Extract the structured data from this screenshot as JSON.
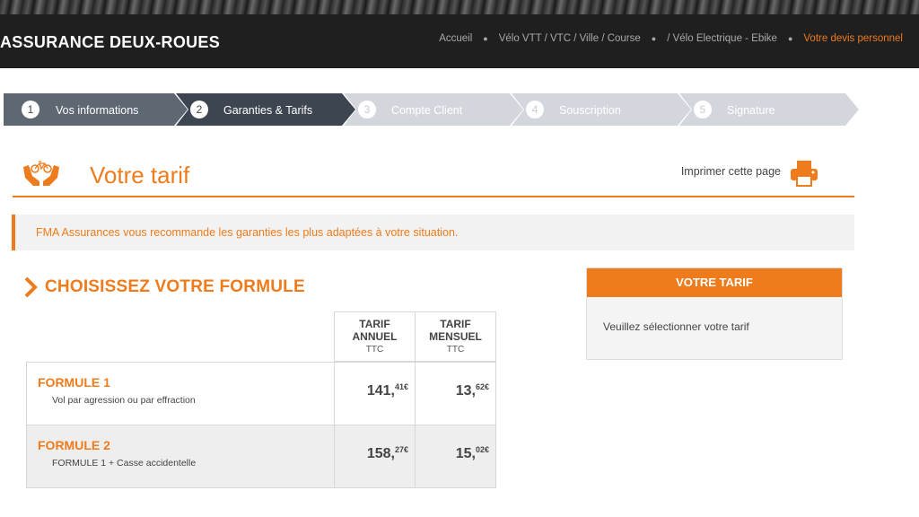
{
  "header": {
    "brand": "ASSURANCE DEUX-ROUES",
    "breadcrumb": [
      {
        "label": "Accueil"
      },
      {
        "label": "Vélo VTT / VTC / Ville / Course"
      },
      {
        "label": "/ Vélo Electrique - Ebike"
      },
      {
        "label": "Votre devis personnel"
      }
    ]
  },
  "steps": [
    {
      "num": "1",
      "label": "Vos informations"
    },
    {
      "num": "2",
      "label": "Garanties & Tarifs"
    },
    {
      "num": "3",
      "label": "Compte Client"
    },
    {
      "num": "4",
      "label": "Souscription"
    },
    {
      "num": "5",
      "label": "Signature"
    }
  ],
  "page": {
    "title": "Votre tarif",
    "print_label": "Imprimer cette page",
    "notice": "FMA Assurances vous recommande les garanties les plus adaptées à votre situation.",
    "section_title": "CHOISISSEZ VOTRE FORMULE"
  },
  "table": {
    "headers": [
      {
        "line1": "TARIF",
        "line2": "ANNUEL",
        "line3": "TTC"
      },
      {
        "line1": "TARIF",
        "line2": "MENSUEL",
        "line3": "TTC"
      }
    ],
    "rows": [
      {
        "name": "FORMULE 1",
        "desc": "Vol par agression ou par effraction",
        "annual": {
          "int": "141,",
          "dec": "41€"
        },
        "monthly": {
          "int": "13,",
          "dec": "62€"
        }
      },
      {
        "name": "FORMULE 2",
        "desc": "FORMULE 1 + Casse accidentelle",
        "annual": {
          "int": "158,",
          "dec": "27€"
        },
        "monthly": {
          "int": "15,",
          "dec": "02€"
        }
      }
    ]
  },
  "sidebar": {
    "title": "VOTRE TARIF",
    "message": "Veuillez sélectionner votre tarif"
  },
  "colors": {
    "accent": "#ee7b1c",
    "topbar": "#1f1f1f",
    "step_done_dark": "#3d4650",
    "step_done": "#5e6873",
    "step_todo": "#d3d7dd",
    "row_alt": "#eeeeee"
  },
  "icons": [
    "hands-bike-icon",
    "printer-icon",
    "chevron-right-icon"
  ]
}
